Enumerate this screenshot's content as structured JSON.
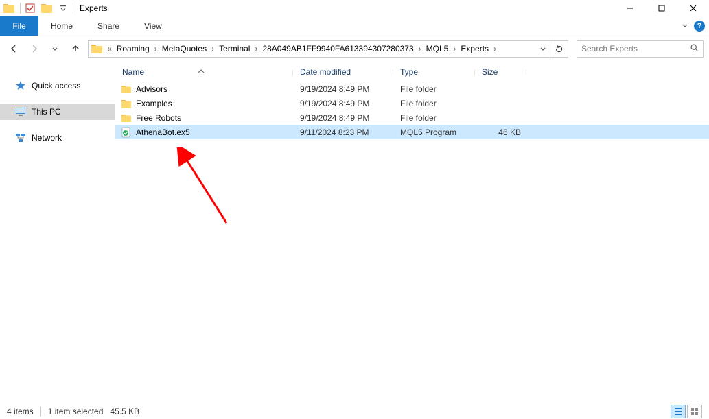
{
  "window": {
    "title": "Experts",
    "minimize": "Minimize",
    "maximize": "Maximize",
    "close": "Close"
  },
  "ribbon": {
    "file": "File",
    "tabs": [
      "Home",
      "Share",
      "View"
    ]
  },
  "breadcrumb": {
    "segments": [
      "Roaming",
      "MetaQuotes",
      "Terminal",
      "28A049AB1FF9940FA613394307280373",
      "MQL5",
      "Experts"
    ]
  },
  "search": {
    "placeholder": "Search Experts"
  },
  "navpane": {
    "items": [
      {
        "label": "Quick access",
        "kind": "quick"
      },
      {
        "label": "This PC",
        "kind": "pc",
        "selected": true
      },
      {
        "label": "Network",
        "kind": "net"
      }
    ]
  },
  "columns": {
    "name": "Name",
    "date": "Date modified",
    "type": "Type",
    "size": "Size"
  },
  "rows": [
    {
      "name": "Advisors",
      "date": "9/19/2024 8:49 PM",
      "type": "File folder",
      "size": "",
      "icon": "folder"
    },
    {
      "name": "Examples",
      "date": "9/19/2024 8:49 PM",
      "type": "File folder",
      "size": "",
      "icon": "folder"
    },
    {
      "name": "Free Robots",
      "date": "9/19/2024 8:49 PM",
      "type": "File folder",
      "size": "",
      "icon": "folder"
    },
    {
      "name": "AthenaBot.ex5",
      "date": "9/11/2024 8:23 PM",
      "type": "MQL5 Program",
      "size": "46 KB",
      "icon": "ex5",
      "selected": true
    }
  ],
  "status": {
    "count": "4 items",
    "selection": "1 item selected",
    "selsize": "45.5 KB"
  }
}
